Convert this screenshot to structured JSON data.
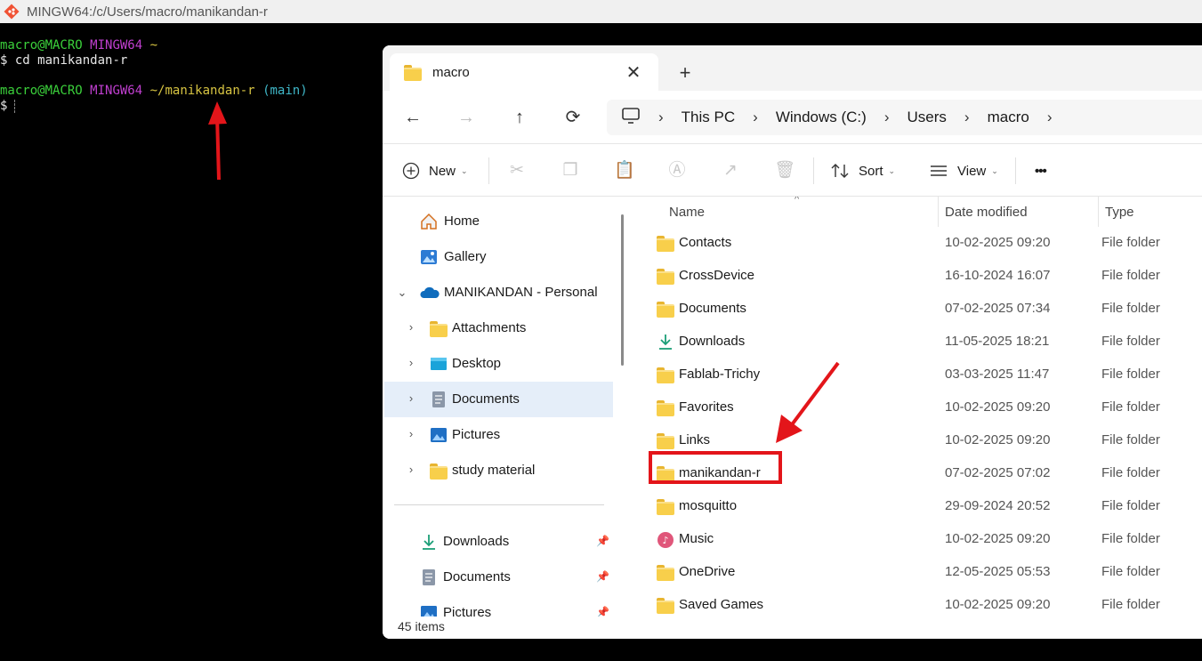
{
  "terminal": {
    "window_title": "MINGW64:/c/Users/macro/manikandan-r",
    "lines": [
      {
        "user_host": "macro@MACRO",
        "shell": "MINGW64",
        "path": "~",
        "branch": ""
      },
      {
        "prompt": "$",
        "command": "cd manikandan-r"
      },
      {
        "user_host": "macro@MACRO",
        "shell": "MINGW64",
        "path": "~/manikandan-r",
        "branch": "(main)"
      },
      {
        "prompt": "$",
        "command": ""
      }
    ]
  },
  "explorer": {
    "tab": {
      "label": "macro",
      "close_glyph": "✕",
      "new_tab_glyph": "+"
    },
    "nav_buttons": {
      "back": "←",
      "forward": "→",
      "up": "↑",
      "refresh": "⟳"
    },
    "breadcrumb": [
      "This PC",
      "Windows (C:)",
      "Users",
      "macro"
    ],
    "toolbar": {
      "new_label": "New",
      "sort_label": "Sort",
      "view_label": "View",
      "more_glyph": "•••"
    },
    "nav_pane": {
      "items": [
        {
          "label": "Home",
          "icon": "home-icon"
        },
        {
          "label": "Gallery",
          "icon": "gallery-icon"
        },
        {
          "label": "MANIKANDAN - Personal",
          "icon": "onedrive-icon",
          "expanded": true
        },
        {
          "label": "Attachments",
          "icon": "folder-icon"
        },
        {
          "label": "Desktop",
          "icon": "desktop-icon"
        },
        {
          "label": "Documents",
          "icon": "documents-icon",
          "selected": true
        },
        {
          "label": "Pictures",
          "icon": "pictures-icon"
        },
        {
          "label": "study material",
          "icon": "folder-icon"
        }
      ],
      "quick_access": [
        {
          "label": "Downloads",
          "icon": "download-icon",
          "pinned": true
        },
        {
          "label": "Documents",
          "icon": "documents-icon",
          "pinned": true
        },
        {
          "label": "Pictures",
          "icon": "pictures-icon",
          "pinned": true
        }
      ]
    },
    "columns": {
      "name": "Name",
      "date": "Date modified",
      "type": "Type"
    },
    "files": [
      {
        "name": "Contacts",
        "date": "10-02-2025 09:20",
        "type": "File folder",
        "icon": "folder-icon"
      },
      {
        "name": "CrossDevice",
        "date": "16-10-2024 16:07",
        "type": "File folder",
        "icon": "folder-icon"
      },
      {
        "name": "Documents",
        "date": "07-02-2025 07:34",
        "type": "File folder",
        "icon": "folder-icon"
      },
      {
        "name": "Downloads",
        "date": "11-05-2025 18:21",
        "type": "File folder",
        "icon": "download-icon"
      },
      {
        "name": "Fablab-Trichy",
        "date": "03-03-2025 11:47",
        "type": "File folder",
        "icon": "folder-icon"
      },
      {
        "name": "Favorites",
        "date": "10-02-2025 09:20",
        "type": "File folder",
        "icon": "folder-icon"
      },
      {
        "name": "Links",
        "date": "10-02-2025 09:20",
        "type": "File folder",
        "icon": "folder-icon"
      },
      {
        "name": "manikandan-r",
        "date": "07-02-2025 07:02",
        "type": "File folder",
        "icon": "folder-icon",
        "highlighted": true
      },
      {
        "name": "mosquitto",
        "date": "29-09-2024 20:52",
        "type": "File folder",
        "icon": "folder-icon"
      },
      {
        "name": "Music",
        "date": "10-02-2025 09:20",
        "type": "File folder",
        "icon": "music-icon"
      },
      {
        "name": "OneDrive",
        "date": "12-05-2025 05:53",
        "type": "File folder",
        "icon": "folder-icon"
      },
      {
        "name": "Saved Games",
        "date": "10-02-2025 09:20",
        "type": "File folder",
        "icon": "folder-icon"
      }
    ],
    "status": "45 items"
  },
  "colors": {
    "terminal_bg": "#000000",
    "prompt_green": "#3bd13b",
    "prompt_purple": "#c03fd0",
    "path_yellow": "#d7c442",
    "branch_cyan": "#3fb7c8",
    "annotation_red": "#e3151a",
    "selection_blue": "#e5eef9"
  }
}
